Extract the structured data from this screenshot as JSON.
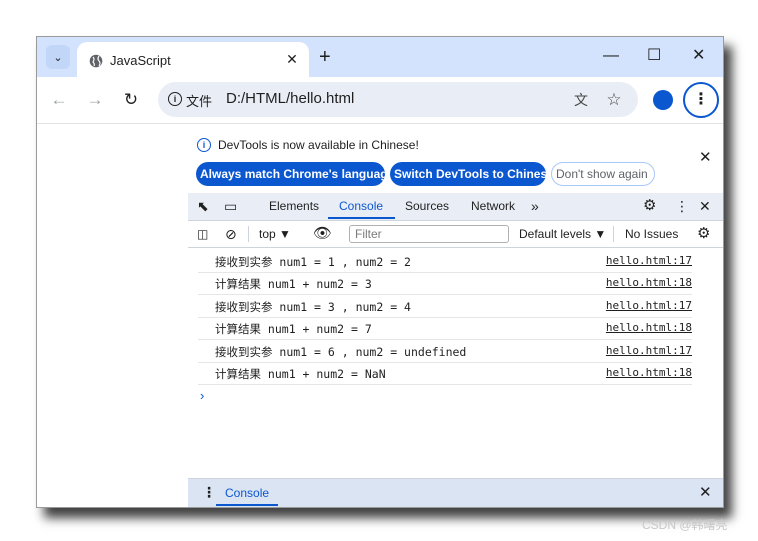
{
  "browser": {
    "tab_title": "JavaScript",
    "chip_label": "文件",
    "url": "D:/HTML/hello.html"
  },
  "devtools": {
    "banner": {
      "text": "DevTools is now available in Chinese!",
      "btn_match": "Always match Chrome's language",
      "btn_switch": "Switch DevTools to Chinese",
      "btn_dont": "Don't show again"
    },
    "tabs": [
      "Elements",
      "Console",
      "Sources",
      "Network"
    ],
    "active_tab": "Console",
    "console_bar": {
      "context": "top",
      "filter_placeholder": "Filter",
      "levels": "Default levels",
      "issues": "No Issues"
    },
    "logs": [
      {
        "message": "接收到实参 num1 = 1 , num2 = 2",
        "source": "hello.html:17"
      },
      {
        "message": "计算结果 num1 + num2 = 3",
        "source": "hello.html:18"
      },
      {
        "message": "接收到实参 num1 = 3 , num2 = 4",
        "source": "hello.html:17"
      },
      {
        "message": "计算结果 num1 + num2 = 7",
        "source": "hello.html:18"
      },
      {
        "message": "接收到实参 num1 = 6 , num2 = undefined",
        "source": "hello.html:17"
      },
      {
        "message": "计算结果 num1 + num2 = NaN",
        "source": "hello.html:18"
      }
    ],
    "drawer_tab": "Console"
  },
  "watermark": "CSDN @韩曙亮",
  "colors": {
    "accent": "#0b57d0",
    "tabstrip": "#d3e3fd"
  }
}
